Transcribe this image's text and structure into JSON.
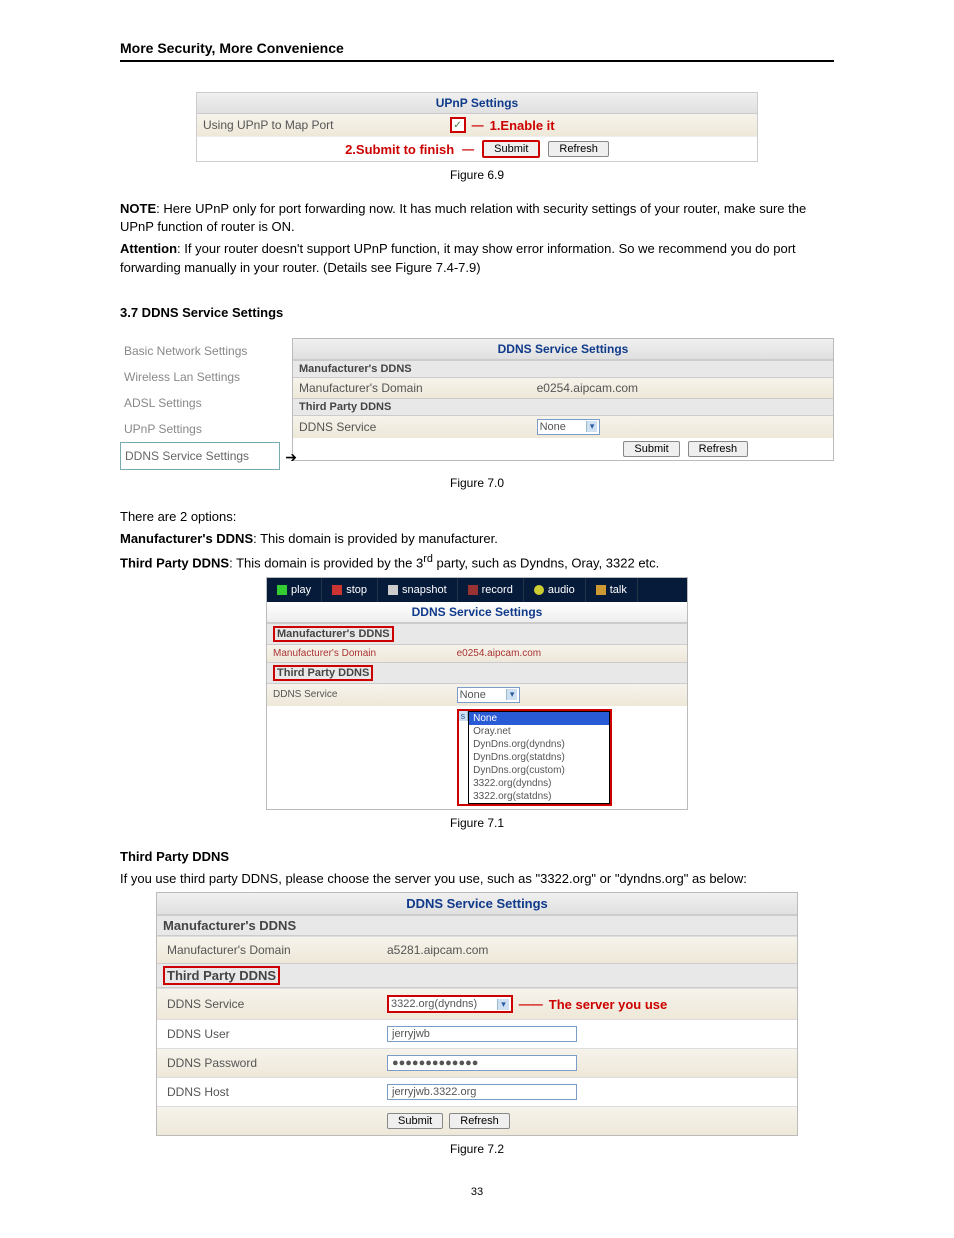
{
  "header": {
    "title": "More Security, More Convenience"
  },
  "fig69": {
    "panel_title": "UPnP Settings",
    "row_label": "Using UPnP to Map Port",
    "callout1": "1.Enable it",
    "callout2": "2.Submit to finish",
    "submit": "Submit",
    "refresh": "Refresh",
    "caption": "Figure 6.9"
  },
  "note": {
    "note_label": "NOTE",
    "note_text": ": Here UPnP only for port forwarding now. It has much relation with security settings of your router, make sure the UPnP function of router is ON.",
    "attn_label": "Attention",
    "attn_text": ": If your router doesn't support UPnP function, it may show error information. So we recommend you do port forwarding manually in your router. (Details see Figure 7.4-7.9)"
  },
  "sec37": {
    "title": "3.7 DDNS Service Settings"
  },
  "sidebar": {
    "items": [
      "Basic Network Settings",
      "Wireless Lan Settings",
      "ADSL Settings",
      "UPnP Settings",
      "DDNS Service Settings"
    ]
  },
  "fig70": {
    "panel_title": "DDNS Service Settings",
    "sub1": "Manufacturer's DDNS",
    "mdomain_label": "Manufacturer's Domain",
    "mdomain_value": "e0254.aipcam.com",
    "sub2": "Third Party DDNS",
    "service_label": "DDNS Service",
    "service_value": "None",
    "submit": "Submit",
    "refresh": "Refresh",
    "caption": "Figure 7.0"
  },
  "opts": {
    "lead": "There are 2 options:",
    "m_label": "Manufacturer's DDNS",
    "m_text": ": This domain is provided by manufacturer.",
    "t_label": "Third Party DDNS",
    "t_text_a": ": This domain is provided by the 3",
    "t_sup": "rd",
    "t_text_b": " party, such as Dyndns, Oray, 3322 etc."
  },
  "fig71": {
    "toolbar": {
      "play": "play",
      "stop": "stop",
      "snapshot": "snapshot",
      "record": "record",
      "audio": "audio",
      "talk": "talk"
    },
    "panel_title": "DDNS Service Settings",
    "sub1": "Manufacturer's DDNS",
    "mdomain_label": "Manufacturer's Domain",
    "mdomain_value": "e0254.aipcam.com",
    "sub2": "Third Party DDNS",
    "service_label": "DDNS Service",
    "service_value": "None",
    "options": [
      "None",
      "Oray.net",
      "DynDns.org(dyndns)",
      "DynDns.org(statdns)",
      "DynDns.org(custom)",
      "3322.org(dyndns)",
      "3322.org(statdns)"
    ],
    "caption": "Figure 7.1"
  },
  "tp": {
    "heading": "Third Party DDNS",
    "text": "If you use third party DDNS, please choose the server you use, such as \"3322.org\" or \"dyndns.org\" as below:"
  },
  "fig72": {
    "panel_title": "DDNS Service Settings",
    "sub1": "Manufacturer's DDNS",
    "mdomain_label": "Manufacturer's Domain",
    "mdomain_value": "a5281.aipcam.com",
    "sub2": "Third Party DDNS",
    "service_label": "DDNS Service",
    "service_value": "3322.org(dyndns)",
    "callout": "The server you use",
    "user_label": "DDNS User",
    "user_value": "jerryjwb",
    "pwd_label": "DDNS Password",
    "pwd_value": "●●●●●●●●●●●●●",
    "host_label": "DDNS Host",
    "host_value": "jerryjwb.3322.org",
    "submit": "Submit",
    "refresh": "Refresh",
    "caption": "Figure 7.2"
  },
  "page": "33"
}
